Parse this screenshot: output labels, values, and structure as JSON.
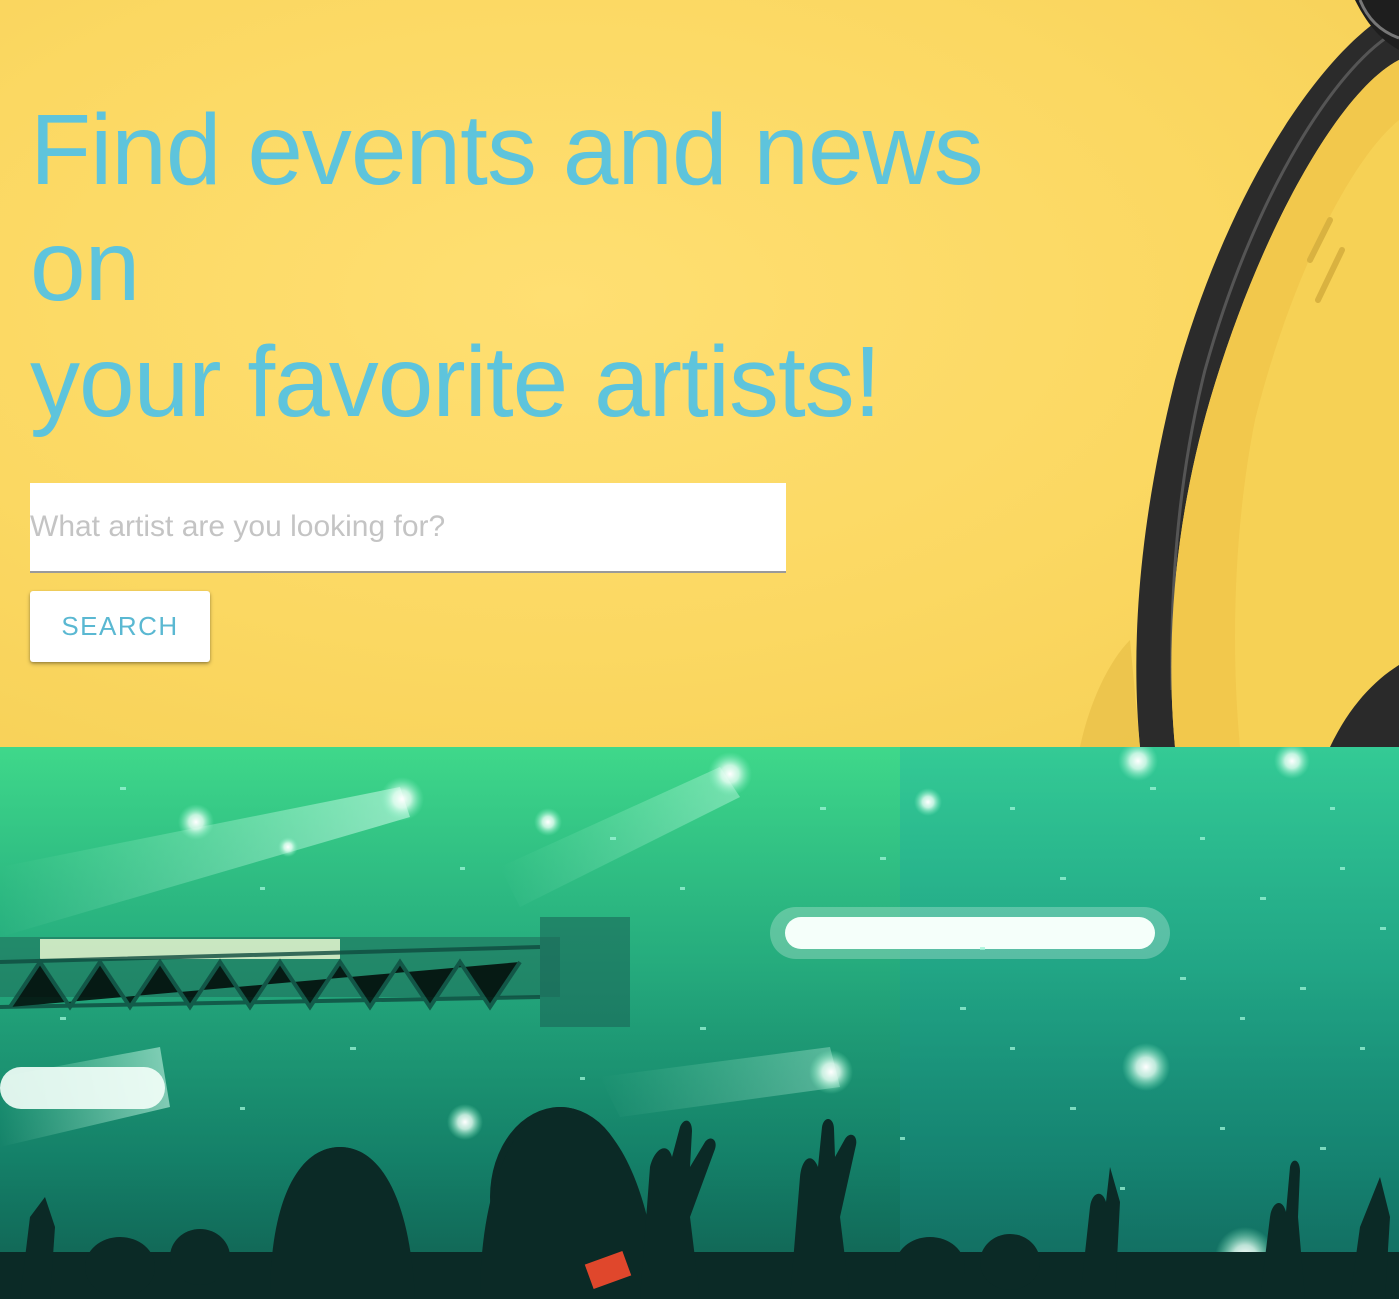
{
  "hero": {
    "title_lines": [
      "Find events and news",
      "on",
      "your favorite artists!"
    ],
    "search": {
      "placeholder": "What artist are you looking for?",
      "value": ""
    },
    "search_button_label": "SEARCH"
  },
  "colors": {
    "accent": "#5ec4dc",
    "hero_background": "#fbd862",
    "concert_background": "#2cc38a"
  },
  "images": {
    "hero_image": "headphones-on-yellow",
    "concert_image": "concert-crowd-green-lights"
  }
}
